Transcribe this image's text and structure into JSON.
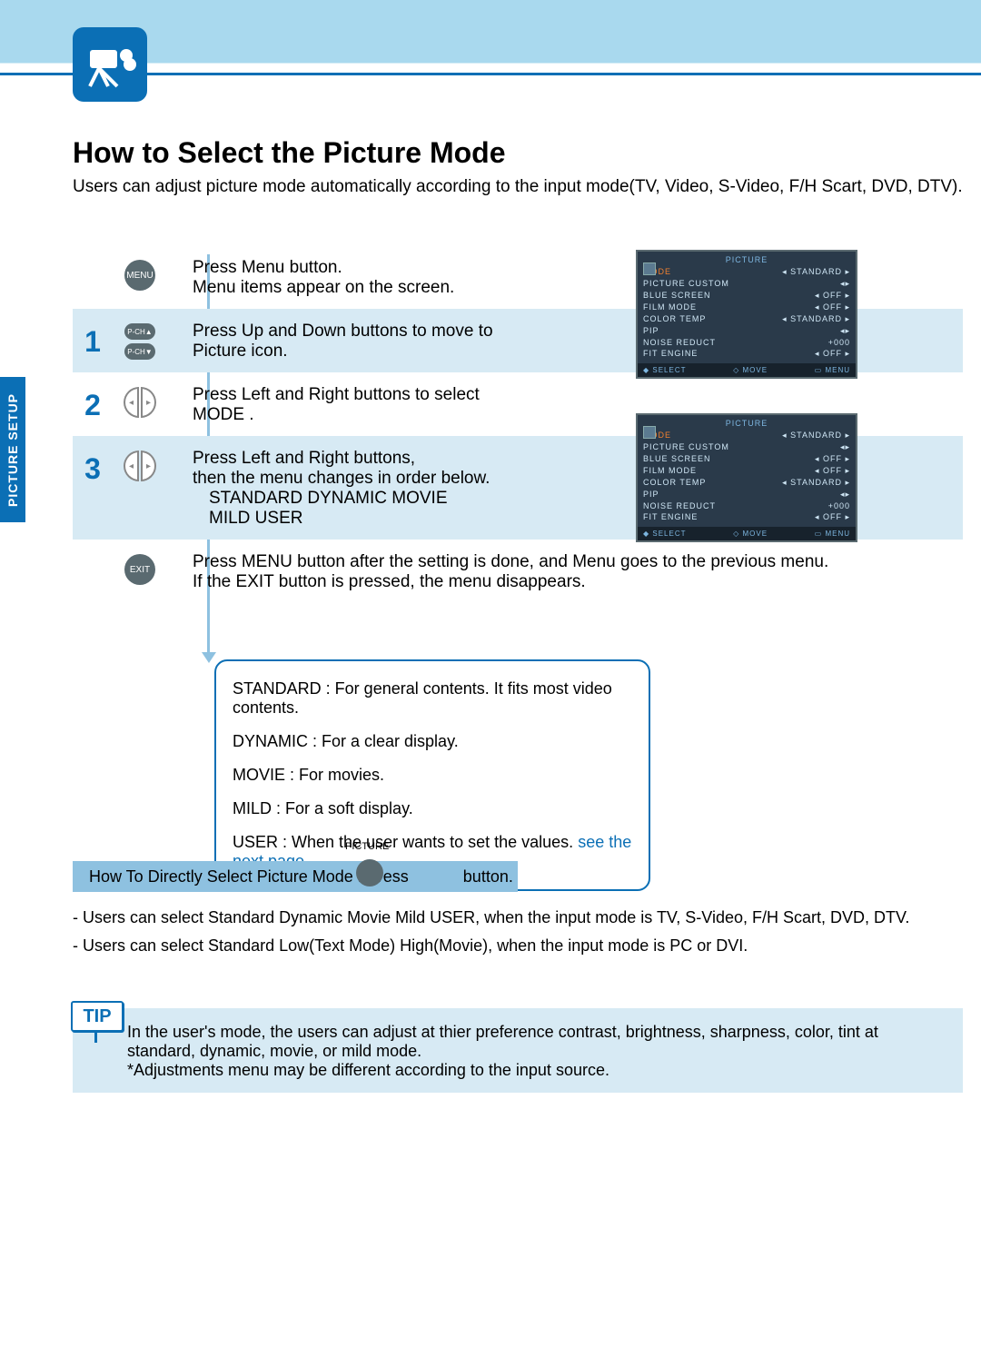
{
  "side_tab": "PICTURE SETUP",
  "title": "How to Select the Picture Mode",
  "subtitle": "Users can adjust picture mode automatically according to the input mode(TV, Video, S-Video, F/H Scart, DVD, DTV).",
  "step0": {
    "btn": "MENU",
    "line1": "Press Menu button.",
    "line2": "Menu items appear on the screen."
  },
  "step1": {
    "num": "1",
    "btn_up": "P-CH▲",
    "btn_dn": "P-CH▼",
    "line1": "Press Up and Down buttons to move to",
    "line2": " Picture  icon."
  },
  "step2": {
    "num": "2",
    "line1": "Press Left and Right buttons to select",
    "line2": " MODE ."
  },
  "step3": {
    "num": "3",
    "line1": "Press Left and Right buttons,",
    "line2": "then the menu changes in order below.",
    "seq1": "STANDARD DYNAMIC  MOVIE",
    "seq2": "MILD   USER"
  },
  "stepExit": {
    "btn": "EXIT",
    "line1": "Press MENU button after the setting is done, and Menu goes to the previous menu.",
    "line2": "If the EXIT button is pressed, the menu disappears."
  },
  "osd": {
    "title": "PICTURE",
    "rows": [
      {
        "label": "MODE",
        "val": "STANDARD",
        "sel": true
      },
      {
        "label": "PICTURE CUSTOM",
        "val": "",
        "arrows": "cont"
      },
      {
        "label": "BLUE SCREEN",
        "val": "OFF"
      },
      {
        "label": "FILM MODE",
        "val": "OFF"
      },
      {
        "label": "COLOR TEMP",
        "val": "STANDARD"
      },
      {
        "label": "PIP",
        "val": "",
        "arrows": "cont"
      },
      {
        "label": "NOISE REDUCT",
        "val": "+000",
        "arrows": "none"
      },
      {
        "label": "FIT ENGINE",
        "val": "OFF"
      }
    ],
    "foot": {
      "a": "◆ SELECT",
      "b": "◇ MOVE",
      "c": "▭ MENU"
    }
  },
  "desc": {
    "l1": "STANDARD : For general contents. It fits most video contents.",
    "l2": "DYNAMIC : For a clear display.",
    "l3": "MOVIE : For movies.",
    "l4": "MILD : For a soft display.",
    "l5a": "USER : When the user wants to set the values. ",
    "l5b": "see the next page"
  },
  "direct": {
    "pic_label": "PICTURE",
    "band_a": "How To Directly Select Picture Mode : Press",
    "band_b": "button."
  },
  "notes": {
    "n1": "- Users can select Standard Dynamic   Movie    Mild     USER, when the input mode is TV, S-Video, F/H Scart, DVD, DTV.",
    "n2": "- Users can select Standard Low(Text Mode)  High(Movie), when the input mode is PC or DVI."
  },
  "tip": {
    "badge": "TIP",
    "l1": "In the user's mode, the users can adjust at thier preference contrast, brightness, sharpness, color, tint at standard, dynamic, movie, or mild mode.",
    "l2": "*Adjustments menu may be different according to the input source."
  }
}
